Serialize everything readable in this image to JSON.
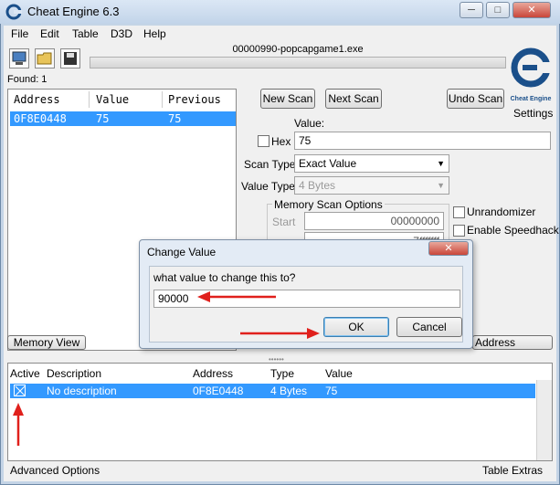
{
  "window": {
    "title": "Cheat Engine 6.3",
    "minimize": "─",
    "maximize": "□",
    "close": "✕"
  },
  "menu": [
    "File",
    "Edit",
    "Table",
    "D3D",
    "Help"
  ],
  "process": {
    "name": "00000990-popcapgame1.exe"
  },
  "found": "Found: 1",
  "results_table": {
    "headers": [
      "Address",
      "Value",
      "Previous"
    ],
    "rows": [
      {
        "address": "0F8E0448",
        "value": "75",
        "previous": "75"
      }
    ]
  },
  "scan": {
    "new_scan": "New Scan",
    "next_scan": "Next Scan",
    "undo_scan": "Undo Scan",
    "settings": "Settings",
    "logo_text": "Cheat Engine",
    "value_label": "Value:",
    "hex_label": "Hex",
    "value": "75",
    "scan_type_label": "Scan Type",
    "scan_type": "Exact Value",
    "value_type_label": "Value Type",
    "value_type": "4 Bytes",
    "memory_options_label": "Memory Scan Options",
    "start_label": "Start",
    "start_value": "00000000",
    "stop_value": "7fffffff",
    "unrandomizer": "Unrandomizer",
    "speedhack": "Enable Speedhack"
  },
  "bottom_buttons": {
    "memory_view": "Memory View",
    "add_manually": "Address Manually"
  },
  "cheat_table": {
    "headers": [
      "Active",
      "Description",
      "Address",
      "Type",
      "Value"
    ],
    "rows": [
      {
        "description": "No description",
        "address": "0F8E0448",
        "type": "4 Bytes",
        "value": "75"
      }
    ]
  },
  "footer": {
    "advanced": "Advanced Options",
    "extras": "Table Extras"
  },
  "dialog": {
    "title": "Change Value",
    "prompt": "what value to change this to?",
    "value": "90000",
    "ok": "OK",
    "cancel": "Cancel",
    "close": "✕"
  },
  "colors": {
    "selection": "#3399ff",
    "arrow": "#e0201c"
  }
}
